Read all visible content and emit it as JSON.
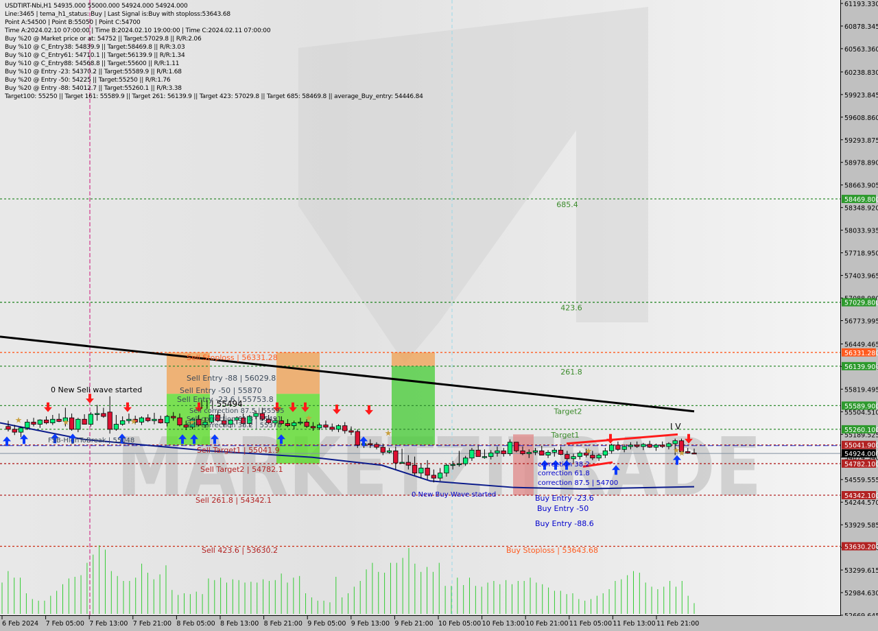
{
  "header": {
    "lines": [
      "USDTIRT-Nbi,H1  54935.000 55000.000 54924.000 54924.000",
      "Line:3465 | tema_h1_status: Buy | Last Signal is:Buy with stoploss:53643.68",
      "Point A:54500 | Point B:55050 | Point C:54700",
      "Time A:2024.02.10 07:00:00 | Time B:2024.02.10 19:00:00 | Time C:2024.02.11 07:00:00",
      "Buy %20 @ Market price or at: 54752 || Target:57029.8 || R/R:2.06",
      "Buy %10 @ C_Entry38: 54839.9 || Target:58469.8 || R/R:3.03",
      "Buy %10 @ C_Entry61: 54710.1 || Target:56139.9 || R/R:1.34",
      "Buy %10 @ C_Entry88: 54568.8 || Target:55600 || R/R:1.11",
      "Buy %10 @ Entry -23: 54370.2 || Target:55589.9 || R/R:1.68",
      "Buy %20 @ Entry -50: 54225 || Target:55250 || R/R:1.76",
      "Buy %20 @ Entry -88: 54012.7 || Target:55260.1 || R/R:3.38",
      "Target100: 55250 || Target 161: 55589.9 || Target 261: 56139.9 || Target 423: 57029.8 || Target 685: 58469.8 || average_Buy_entry: 54446.84"
    ]
  },
  "chart_data": {
    "type": "candlestick",
    "symbol": "USDTIRT-Nbi",
    "timeframe": "H1",
    "ylim": [
      52669.645,
      61193.33
    ],
    "y_ticks": [
      "61193.330",
      "60878.345",
      "60563.360",
      "60238.830",
      "59923.845",
      "59608.860",
      "59293.875",
      "58978.890",
      "58663.905",
      "58348.920",
      "58033.935",
      "57718.950",
      "57403.965",
      "57088.980",
      "56773.995",
      "56449.465",
      "56134.480",
      "55819.495",
      "55504.510",
      "55189.525",
      "54874.540",
      "54559.555",
      "54244.570",
      "53929.585",
      "53614.600",
      "53299.615",
      "52984.630",
      "52669.645"
    ],
    "x_ticks": [
      "6 Feb 2024",
      "7 Feb 05:00",
      "7 Feb 13:00",
      "7 Feb 21:00",
      "8 Feb 05:00",
      "8 Feb 13:00",
      "8 Feb 21:00",
      "9 Feb 05:00",
      "9 Feb 13:00",
      "9 Feb 21:00",
      "10 Feb 05:00",
      "10 Feb 13:00",
      "10 Feb 21:00",
      "11 Feb 05:00",
      "11 Feb 13:00",
      "11 Feb 21:00"
    ],
    "price_tags": [
      {
        "value": 58469.8,
        "label": "58469.800",
        "color": "#2e9a2e"
      },
      {
        "value": 57029.8,
        "label": "57029.800",
        "color": "#2e9a2e"
      },
      {
        "value": 56331.28,
        "label": "56331.280",
        "color": "#ff5a1e"
      },
      {
        "value": 56139.9,
        "label": "56139.900",
        "color": "#2e9a2e"
      },
      {
        "value": 55589.9,
        "label": "55589.900",
        "color": "#2e9a2e"
      },
      {
        "value": 55260.1,
        "label": "55260.100",
        "color": "#2e9a2e"
      },
      {
        "value": 55041.9,
        "label": "55041.900",
        "color": "#b22222"
      },
      {
        "value": 54924.0,
        "label": "54924.000",
        "color": "#000000"
      },
      {
        "value": 54782.1,
        "label": "54782.100",
        "color": "#b22222"
      },
      {
        "value": 54342.1,
        "label": "54342.100",
        "color": "#b22222"
      },
      {
        "value": 53630.2,
        "label": "53630.200",
        "color": "#b22222"
      }
    ],
    "levels": [
      {
        "value": 58469.8,
        "color": "#2e8b2e",
        "label": "685.4"
      },
      {
        "value": 57029.8,
        "color": "#2e8b2e",
        "label": "423.6"
      },
      {
        "value": 56331.28,
        "color": "#ff5a1e",
        "label": ""
      },
      {
        "value": 56139.9,
        "color": "#2e8b2e",
        "label": "261.8"
      },
      {
        "value": 55589.9,
        "color": "#2e8b2e",
        "label": "Target2"
      },
      {
        "value": 55260.1,
        "color": "#2e8b2e",
        "label": "Target1"
      },
      {
        "value": 55041.9,
        "color": "#b22222",
        "label": ""
      },
      {
        "value": 54782.1,
        "color": "#b22222",
        "label": ""
      },
      {
        "value": 54342.1,
        "color": "#b22222",
        "label": ""
      },
      {
        "value": 53630.2,
        "color": "#cc2a10",
        "label": ""
      }
    ],
    "annotations": [
      {
        "text": "Sell Stoploss | 56331.28",
        "color": "#ff5a1e"
      },
      {
        "text": "Sell Entry -88 | 56029.8",
        "color": "#3c4a5a"
      },
      {
        "text": "Sell Entry -50 | 55870",
        "color": "#3c4a5a"
      },
      {
        "text": "Sell Entry -23.6 | 55753.8",
        "color": "#3c4a5a"
      },
      {
        "text": "| | | 55494",
        "color": "#000000"
      },
      {
        "text": "Sell correction 87.5 | 55595",
        "color": "#3c4a5a"
      },
      {
        "text": "Sell correction 61.8 | 55491",
        "color": "#3c4a5a"
      },
      {
        "text": "Sell correction 38.2 | 55378",
        "color": "#3c4a5a"
      },
      {
        "text": "0 New Sell wave started",
        "color": "#000000"
      },
      {
        "text": "FSB-HighToBreak | 55048",
        "color": "#3c4a5a"
      },
      {
        "text": "Sell Target1 | 55041.9",
        "color": "#b22222"
      },
      {
        "text": "Sell Target2 | 54782.1",
        "color": "#b22222"
      },
      {
        "text": "Sell  261.8 | 54342.1",
        "color": "#b22222"
      },
      {
        "text": "Sell  423.6 | 53630.2",
        "color": "#b22222"
      },
      {
        "text": "0 New Buy Wave started",
        "color": "#0000cc"
      },
      {
        "text": "correction 38.2",
        "color": "#0000cc"
      },
      {
        "text": "correction 61.8",
        "color": "#0000cc"
      },
      {
        "text": "correction 87.5 | 54700",
        "color": "#0000cc"
      },
      {
        "text": "Buy Entry -23.6",
        "color": "#0000cc"
      },
      {
        "text": "Buy Entry -50",
        "color": "#0000cc"
      },
      {
        "text": "Buy Entry -88.6",
        "color": "#0000cc"
      },
      {
        "text": "Buy Stoploss | 53643.68",
        "color": "#ff5a1e"
      },
      {
        "text": "I V",
        "color": "#000000"
      }
    ],
    "candles": [
      [
        55300,
        55380,
        55230,
        55260
      ],
      [
        55260,
        55320,
        55180,
        55220
      ],
      [
        55220,
        55300,
        55150,
        55280
      ],
      [
        55280,
        55400,
        55250,
        55360
      ],
      [
        55360,
        55420,
        55300,
        55330
      ],
      [
        55330,
        55400,
        55280,
        55390
      ],
      [
        55390,
        55440,
        55330,
        55350
      ],
      [
        55350,
        55460,
        55320,
        55400
      ],
      [
        55400,
        55480,
        55360,
        55370
      ],
      [
        55370,
        55560,
        55300,
        55420
      ],
      [
        55420,
        55480,
        55240,
        55260
      ],
      [
        55260,
        55420,
        55220,
        55400
      ],
      [
        55400,
        55470,
        55360,
        55330
      ],
      [
        55330,
        55500,
        55300,
        55470
      ],
      [
        55470,
        55600,
        55380,
        55480
      ],
      [
        55480,
        55560,
        55420,
        55440
      ],
      [
        55500,
        55720,
        55200,
        55260
      ],
      [
        55260,
        55460,
        55240,
        55330
      ],
      [
        55330,
        55440,
        55310,
        55380
      ],
      [
        55380,
        55480,
        55340,
        55400
      ],
      [
        55400,
        55450,
        55330,
        55360
      ],
      [
        55360,
        55440,
        55320,
        55420
      ],
      [
        55420,
        55470,
        55360,
        55380
      ],
      [
        55380,
        55490,
        55330,
        55400
      ],
      [
        55400,
        55450,
        55340,
        55350
      ],
      [
        55350,
        55460,
        55300,
        55440
      ],
      [
        55440,
        55500,
        55380,
        55420
      ],
      [
        55420,
        55480,
        55300,
        55320
      ],
      [
        55320,
        55380,
        55250,
        55290
      ],
      [
        55290,
        55420,
        55260,
        55400
      ],
      [
        55400,
        55460,
        55300,
        55320
      ],
      [
        55320,
        55430,
        55280,
        55360
      ],
      [
        55360,
        55470,
        55340,
        55460
      ],
      [
        55460,
        55520,
        55360,
        55380
      ],
      [
        55380,
        55480,
        55300,
        55330
      ],
      [
        55330,
        55400,
        55280,
        55390
      ],
      [
        55390,
        55440,
        55330,
        55420
      ],
      [
        55420,
        55480,
        55300,
        55340
      ],
      [
        55340,
        55460,
        55300,
        55440
      ],
      [
        55440,
        55520,
        55400,
        55480
      ],
      [
        55480,
        55560,
        55380,
        55400
      ],
      [
        55400,
        55460,
        55330,
        55350
      ],
      [
        55350,
        55420,
        55300,
        55380
      ],
      [
        55380,
        55440,
        55320,
        55340
      ],
      [
        55340,
        55400,
        55290,
        55310
      ],
      [
        55310,
        55380,
        55260,
        55350
      ],
      [
        55350,
        55420,
        55320,
        55360
      ],
      [
        55360,
        55400,
        55280,
        55300
      ],
      [
        55300,
        55360,
        55240,
        55280
      ],
      [
        55280,
        55350,
        55250,
        55320
      ],
      [
        55320,
        55380,
        55270,
        55290
      ],
      [
        55290,
        55340,
        55230,
        55260
      ],
      [
        55260,
        55330,
        55220,
        55310
      ],
      [
        55310,
        55360,
        55200,
        55240
      ],
      [
        55240,
        55300,
        55180,
        55220
      ],
      [
        55230,
        55260,
        55000,
        55040
      ],
      [
        55040,
        55100,
        55000,
        55060
      ],
      [
        55060,
        55120,
        55000,
        55050
      ],
      [
        55050,
        55080,
        54980,
        55010
      ],
      [
        55010,
        55060,
        54900,
        54940
      ],
      [
        54940,
        55000,
        54920,
        54960
      ],
      [
        54960,
        55020,
        54700,
        54790
      ],
      [
        54790,
        54990,
        54780,
        54800
      ],
      [
        54800,
        54900,
        54700,
        54760
      ],
      [
        54760,
        54880,
        54620,
        54650
      ],
      [
        54650,
        54780,
        54580,
        54720
      ],
      [
        54720,
        54830,
        54560,
        54620
      ],
      [
        54620,
        54700,
        54520,
        54580
      ],
      [
        54580,
        54720,
        54540,
        54650
      ],
      [
        54650,
        54780,
        54600,
        54760
      ],
      [
        54760,
        54820,
        54700,
        54770
      ],
      [
        54770,
        54960,
        54740,
        54780
      ],
      [
        54780,
        54890,
        54750,
        54860
      ],
      [
        54860,
        55000,
        54820,
        54970
      ],
      [
        54970,
        55030,
        54900,
        54880
      ],
      [
        54880,
        54980,
        54850,
        54880
      ],
      [
        54880,
        54970,
        54840,
        54930
      ],
      [
        54930,
        55020,
        54880,
        54960
      ],
      [
        54960,
        55000,
        54880,
        54920
      ],
      [
        54920,
        55120,
        54890,
        55080
      ],
      [
        55080,
        55060,
        54940,
        54960
      ],
      [
        54960,
        55020,
        54900,
        54920
      ],
      [
        54920,
        54980,
        54860,
        54940
      ],
      [
        54940,
        55000,
        54900,
        54960
      ],
      [
        54960,
        55030,
        54920,
        54900
      ],
      [
        54900,
        54970,
        54860,
        54940
      ],
      [
        54940,
        55000,
        54880,
        54970
      ],
      [
        54970,
        55020,
        54900,
        54910
      ],
      [
        54910,
        54960,
        54800,
        54850
      ],
      [
        54850,
        54920,
        54790,
        54880
      ],
      [
        54880,
        54960,
        54840,
        54930
      ],
      [
        54930,
        54990,
        54870,
        54900
      ],
      [
        54900,
        54960,
        54830,
        54860
      ],
      [
        54860,
        54920,
        54820,
        54900
      ],
      [
        54900,
        55000,
        54860,
        54960
      ],
      [
        54960,
        55060,
        54920,
        55040
      ],
      [
        55040,
        55090,
        54960,
        54980
      ],
      [
        54980,
        55050,
        54940,
        55020
      ],
      [
        55020,
        55080,
        54980,
        55040
      ],
      [
        55040,
        55090,
        55000,
        55020
      ],
      [
        55020,
        55070,
        54970,
        55050
      ],
      [
        55050,
        55100,
        55000,
        55010
      ],
      [
        55010,
        55060,
        54960,
        55040
      ],
      [
        55040,
        55090,
        55000,
        55020
      ],
      [
        55020,
        55080,
        54980,
        55060
      ],
      [
        55060,
        55130,
        54900,
        55100
      ],
      [
        55100,
        55130,
        54920,
        54950
      ],
      [
        54950,
        55000,
        54920,
        54930
      ],
      [
        54930,
        54990,
        54920,
        54924
      ]
    ],
    "volumes": [
      38,
      52,
      44,
      44,
      25,
      18,
      16,
      16,
      22,
      28,
      36,
      43,
      45,
      47,
      62,
      72,
      96,
      78,
      52,
      46,
      40,
      40,
      44,
      61,
      50,
      42,
      48,
      59,
      29,
      23,
      25,
      24,
      27,
      24,
      43,
      41,
      44,
      38,
      42,
      41,
      38,
      39,
      38,
      42,
      40,
      41,
      49,
      38,
      44,
      46,
      25,
      20,
      16,
      16,
      14,
      45,
      20,
      25,
      33,
      40,
      54,
      62,
      51,
      50,
      62,
      62,
      68,
      80,
      61,
      51,
      57,
      51,
      62,
      34,
      34,
      44,
      35,
      44,
      34,
      33,
      38,
      40,
      36,
      41,
      36,
      40,
      40,
      44,
      38,
      36,
      32,
      28,
      28,
      24,
      25,
      18,
      16,
      18,
      22,
      25,
      30,
      40,
      42,
      47,
      52,
      50,
      38,
      33,
      30,
      33,
      40,
      33,
      40,
      22,
      13
    ],
    "ema_black": [
      56550,
      55510
    ],
    "ema_blue_points": [
      [
        0,
        55350
      ],
      [
        0.12,
        55120
      ],
      [
        0.3,
        54960
      ],
      [
        0.45,
        54870
      ],
      [
        0.55,
        54760
      ],
      [
        0.62,
        54540
      ],
      [
        0.74,
        54450
      ],
      [
        0.84,
        54430
      ],
      [
        1,
        54460
      ]
    ]
  },
  "watermark": "MARKETZITRADE"
}
